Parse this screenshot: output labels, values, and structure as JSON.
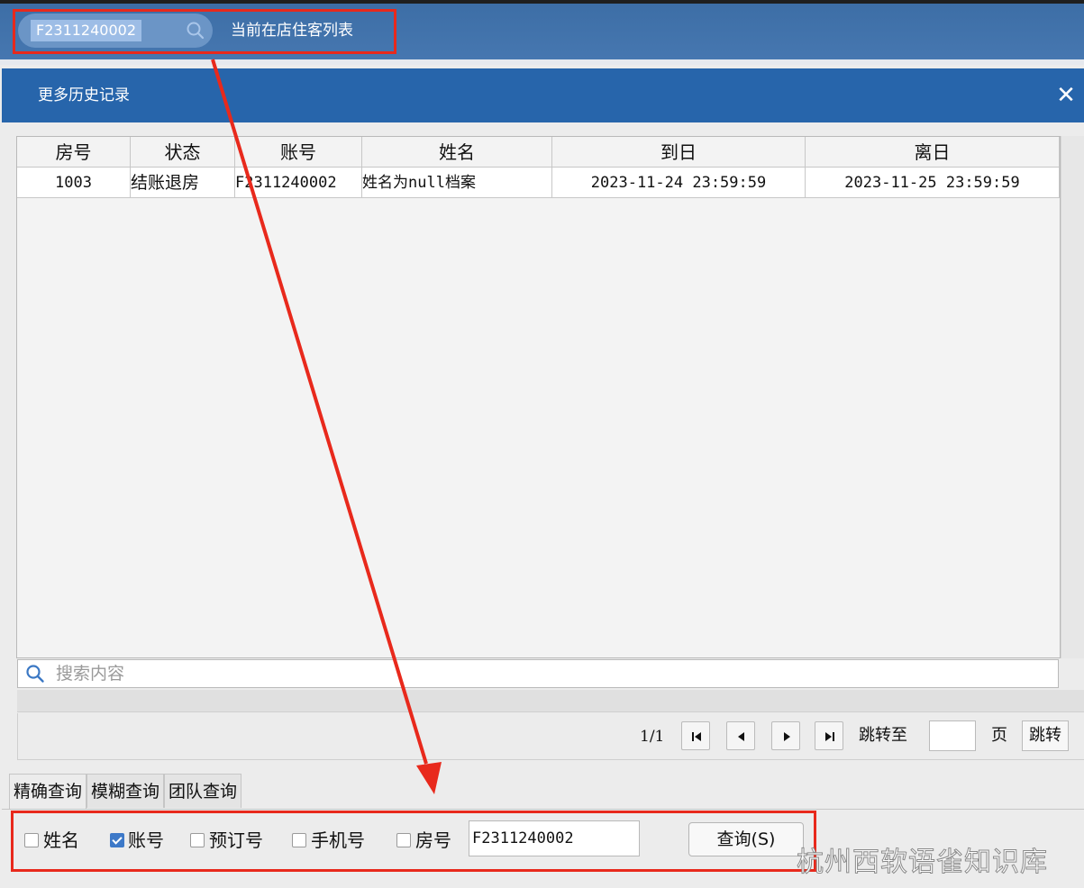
{
  "topbar": {
    "search_value": "F2311240002",
    "title": "当前在店住客列表"
  },
  "dialog": {
    "title": "更多历史记录",
    "close_icon": "close-icon"
  },
  "grid": {
    "columns": [
      "房号",
      "状态",
      "账号",
      "姓名",
      "到日",
      "离日"
    ],
    "rows": [
      [
        "1003",
        "结账退房",
        "F2311240002",
        "姓名为null档案",
        "2023-11-24 23:59:59",
        "2023-11-25 23:59:59"
      ]
    ]
  },
  "filter": {
    "placeholder": "搜索内容"
  },
  "pager": {
    "info": "1/1",
    "jump_label": "跳转至",
    "page_label": "页",
    "go_label": "跳转"
  },
  "tabs": [
    "精确查询",
    "模糊查询",
    "团队查询"
  ],
  "query": {
    "options": [
      {
        "label": "姓名",
        "checked": false
      },
      {
        "label": "账号",
        "checked": true
      },
      {
        "label": "预订号",
        "checked": false
      },
      {
        "label": "手机号",
        "checked": false
      },
      {
        "label": "房号",
        "checked": false
      }
    ],
    "value": "F2311240002",
    "button_label": "查询(S)"
  },
  "watermark": "杭州西软语雀知识库",
  "colors": {
    "header_blue": "#2765ab",
    "annotation_red": "#e8291c",
    "checkbox_blue": "#3d79c8"
  }
}
